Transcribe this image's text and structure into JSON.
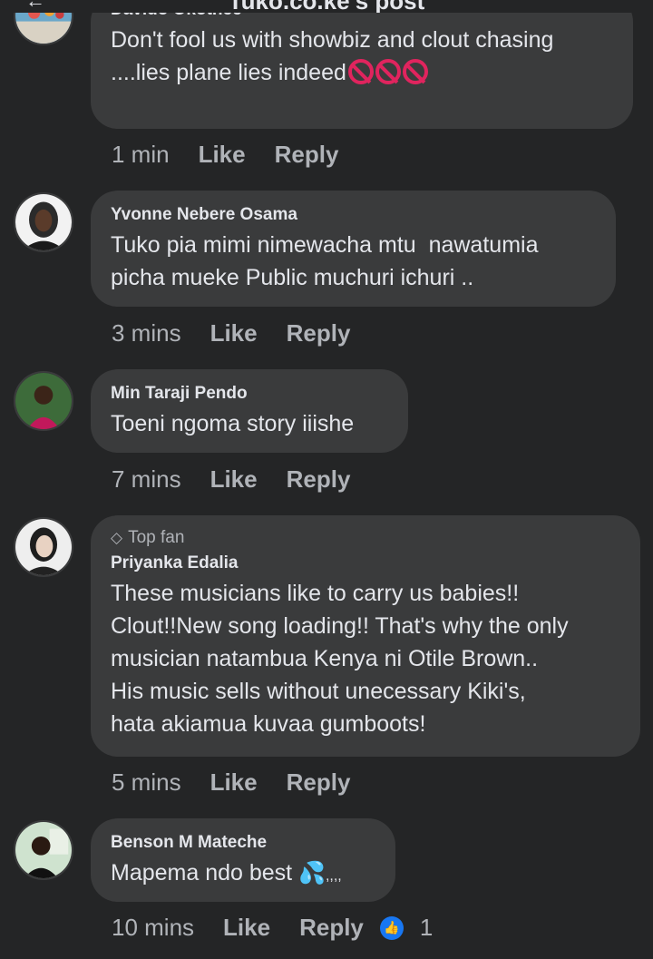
{
  "header": {
    "title": "Tuko.co.ke's post",
    "back_icon": "back-arrow-icon"
  },
  "comments": [
    {
      "name": "Davido Okothee",
      "text": "Don't fool us with showbiz and clout chasing\n....lies plane lies indeed",
      "emoji": "no-entry-sign x3",
      "time": "1 min",
      "like": "Like",
      "reply": "Reply"
    },
    {
      "name": "Yvonne Nebere Osama",
      "text": "Tuko pia mimi nimewacha mtu  nawatumia\npicha mueke Public muchuri ichuri ..",
      "time": "3 mins",
      "like": "Like",
      "reply": "Reply"
    },
    {
      "name": "Min Taraji Pendo",
      "text": "Toeni ngoma story iiishe",
      "time": "7 mins",
      "like": "Like",
      "reply": "Reply"
    },
    {
      "badge": "Top fan",
      "name": "Priyanka Edalia",
      "text": "These musicians like to carry us babies!!\nClout!!New song loading!! That's why the only\nmusician natambua Kenya ni Otile Brown..\nHis music sells without unecessary Kiki's,\nhata akiamua kuvaa gumboots!",
      "time": "5 mins",
      "like": "Like",
      "reply": "Reply"
    },
    {
      "name": "Benson M Mateche",
      "text": "Mapema ndo best",
      "text_suffix": ",,,,",
      "emoji": "sweat-droplets",
      "time": "10 mins",
      "like": "Like",
      "reply": "Reply",
      "reaction_count": "1"
    }
  ],
  "colors": {
    "bg": "#242526",
    "bubble": "#3a3b3c",
    "text": "#e4e6eb",
    "muted": "#b0b3b8",
    "like_blue": "#1877f2"
  }
}
